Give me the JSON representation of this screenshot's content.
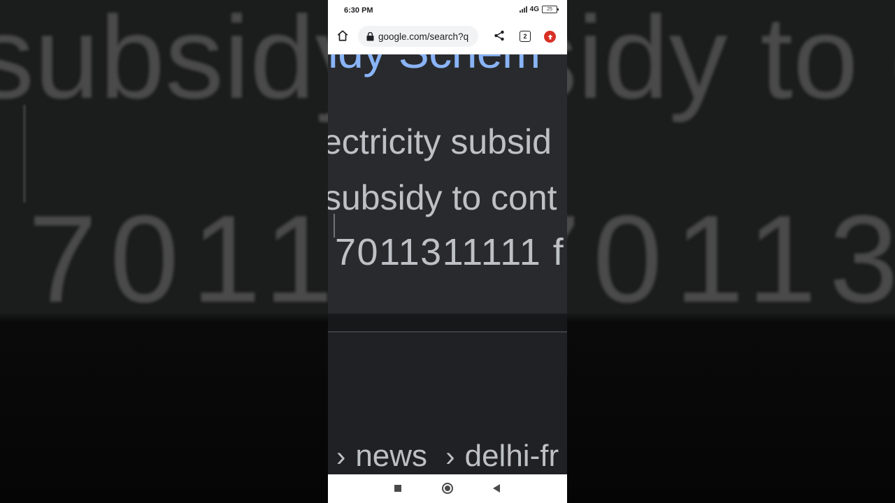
{
  "status_bar": {
    "time": "6:30 PM",
    "network": "4G",
    "battery": "25"
  },
  "browser": {
    "url": "google.com/search?q",
    "tab_count": "2"
  },
  "result": {
    "title_fragment": "idy Schem",
    "snippet_line_1": "ectricity subsid",
    "snippet_line_2": "subsidy to cont",
    "snippet_line_3": "7011311111 f"
  },
  "breadcrumb": {
    "part_1": "news",
    "part_2": "delhi-fr"
  },
  "background": {
    "line_1": "subsidy to cont",
    "line_2": "7011311111 f"
  },
  "colors": {
    "link_blue": "#8ab4f8",
    "snippet_gray": "#bdc1c6",
    "page_bg": "#202124",
    "menu_badge_red": "#d93025"
  },
  "icons": {
    "home": "home-icon",
    "lock": "lock-icon",
    "share": "share-icon",
    "tabs": "tab-switcher-icon",
    "menu": "update-menu-icon"
  }
}
